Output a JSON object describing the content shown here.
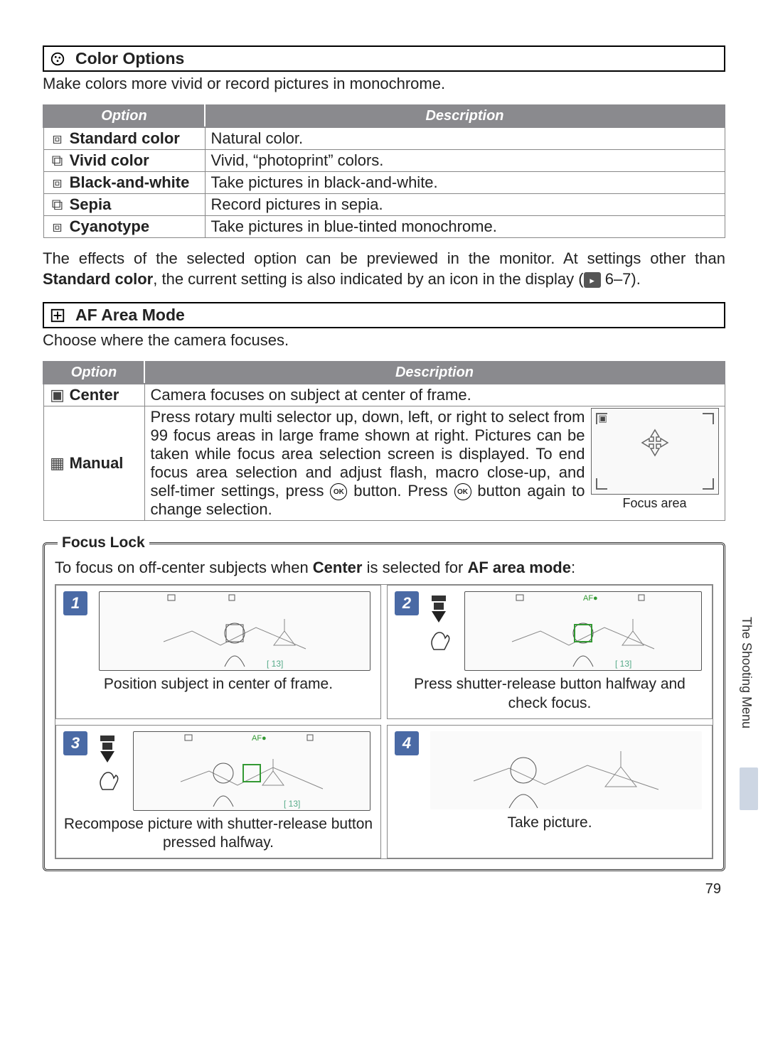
{
  "section1": {
    "title": "Color Options",
    "subtitle": "Make colors more vivid or record pictures in monochrome.",
    "table": {
      "h1": "Option",
      "h2": "Description",
      "rows": [
        {
          "opt": "Standard color",
          "desc": "Natural color."
        },
        {
          "opt": "Vivid color",
          "desc": "Vivid, “photoprint” colors."
        },
        {
          "opt": "Black-and-white",
          "desc": "Take pictures in black-and-white."
        },
        {
          "opt": "Sepia",
          "desc": "Record pictures in sepia."
        },
        {
          "opt": "Cyanotype",
          "desc": "Take pictures in blue-tinted monochrome."
        }
      ]
    }
  },
  "para1": {
    "pre": "The effects of the selected option can be previewed in the monitor.  At settings other than ",
    "bold": "Standard color",
    "post1": ", the current setting is also indicated by an icon in the display (",
    "post2": " 6–7)."
  },
  "section2": {
    "title": "AF Area Mode",
    "subtitle": "Choose where the camera focuses.",
    "table": {
      "h1": "Option",
      "h2": "Description",
      "rows": [
        {
          "opt": "Center",
          "desc": "Camera focuses on subject at center of frame."
        },
        {
          "opt": "Manual",
          "desc_pre": "Press rotary multi selector up, down, left, or right to select from 99 focus areas in large frame shown at right. Pictures can be taken while focus area selection screen is displayed.  To end focus area selection and adjust flash, macro close-up, and self-timer settings, press ",
          "desc_mid": " button.  Press ",
          "desc_post": " button again to change selection.",
          "diag_label": "Focus area"
        }
      ]
    }
  },
  "focus_lock": {
    "title": "Focus Lock",
    "intro_pre": "To focus on off-center subjects when ",
    "intro_b1": "Center",
    "intro_mid": " is selected for ",
    "intro_b2": "AF area mode",
    "intro_post": ":",
    "steps": [
      {
        "n": "1",
        "caption": "Position subject in center of frame."
      },
      {
        "n": "2",
        "caption": "Press shutter-release button halfway and check focus."
      },
      {
        "n": "3",
        "caption": "Recompose picture with shutter-release button pressed halfway."
      },
      {
        "n": "4",
        "caption": "Take picture."
      }
    ]
  },
  "side_tab": "The Shooting Menu",
  "page": "79"
}
